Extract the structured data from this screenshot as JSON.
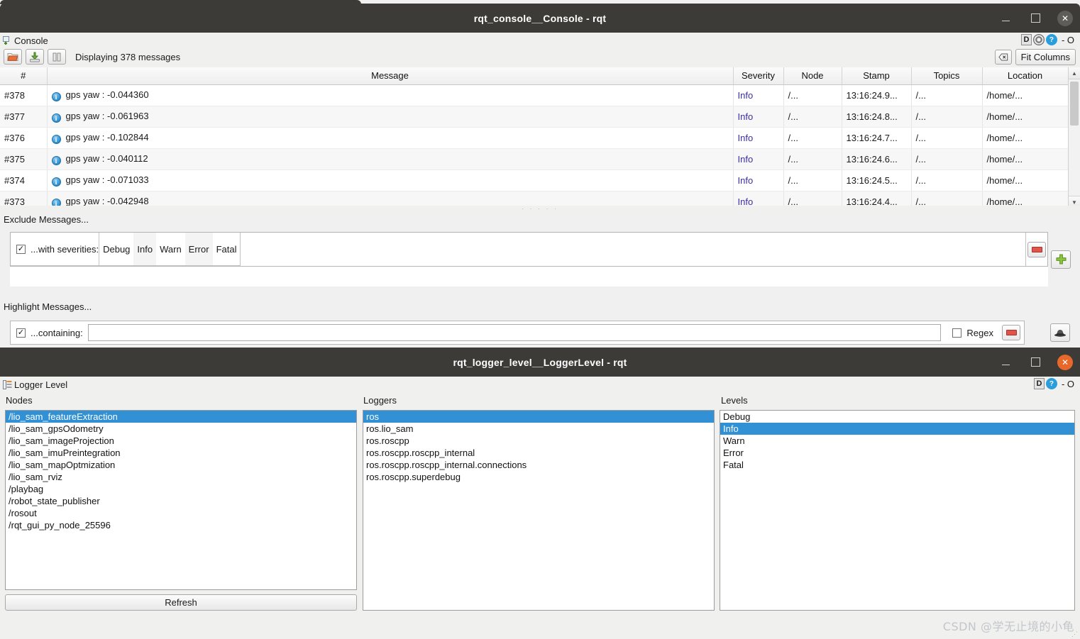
{
  "console_window": {
    "title": "rqt_console__Console - rqt",
    "titlebar_buttons": {
      "minimize": "–",
      "maximize": "□",
      "close": "✕"
    },
    "dock": {
      "title": "Console",
      "icon": "console-dock-icon",
      "controls": {
        "float_label": "D",
        "gear": "⚙",
        "help": "?",
        "extra": "- O"
      }
    },
    "toolbar": {
      "open_icon": "open-folder-icon",
      "save_icon": "save-disk-icon",
      "pause_icon": "pause-icon",
      "status": "Displaying 378 messages",
      "clear_icon": "clear-icon",
      "fit_columns_label": "Fit Columns"
    },
    "table": {
      "columns": [
        "#",
        "Message",
        "Severity",
        "Node",
        "Stamp",
        "Topics",
        "Location"
      ],
      "rows": [
        {
          "num": "#378",
          "message": "gps yaw : -0.044360",
          "severity": "Info",
          "node": "/...",
          "stamp": "13:16:24.9...",
          "topics": "/...",
          "location": "/home/..."
        },
        {
          "num": "#377",
          "message": "gps yaw : -0.061963",
          "severity": "Info",
          "node": "/...",
          "stamp": "13:16:24.8...",
          "topics": "/...",
          "location": "/home/..."
        },
        {
          "num": "#376",
          "message": "gps yaw : -0.102844",
          "severity": "Info",
          "node": "/...",
          "stamp": "13:16:24.7...",
          "topics": "/...",
          "location": "/home/..."
        },
        {
          "num": "#375",
          "message": "gps yaw : -0.040112",
          "severity": "Info",
          "node": "/...",
          "stamp": "13:16:24.6...",
          "topics": "/...",
          "location": "/home/..."
        },
        {
          "num": "#374",
          "message": "gps yaw : -0.071033",
          "severity": "Info",
          "node": "/...",
          "stamp": "13:16:24.5...",
          "topics": "/...",
          "location": "/home/..."
        },
        {
          "num": "#373",
          "message": "gps yaw : -0.042948",
          "severity": "Info",
          "node": "/...",
          "stamp": "13:16:24.4...",
          "topics": "/...",
          "location": "/home/..."
        }
      ]
    },
    "exclude": {
      "label": "Exclude Messages...",
      "checkbox_checked": "✓",
      "row_label": "...with severities:",
      "severities": [
        "Debug",
        "Info",
        "Warn",
        "Error",
        "Fatal"
      ],
      "remove_icon": "minus-icon",
      "add_icon": "plus-icon"
    },
    "highlight": {
      "label": "Highlight Messages...",
      "checkbox_checked": "✓",
      "row_label": "...containing:",
      "text_value": "",
      "regex_label": "Regex",
      "regex_checked": "",
      "remove_icon": "minus-icon",
      "hide_icon": "detective-hat-icon"
    }
  },
  "logger_window": {
    "title": "rqt_logger_level__LoggerLevel - rqt",
    "titlebar_buttons": {
      "minimize": "–",
      "maximize": "□",
      "close": "✕"
    },
    "dock": {
      "title": "Logger Level",
      "icon": "logger-dock-icon",
      "controls": {
        "float_label": "D",
        "help": "?",
        "extra": "- O"
      }
    },
    "nodes": {
      "header": "Nodes",
      "items": [
        "/lio_sam_featureExtraction",
        "/lio_sam_gpsOdometry",
        "/lio_sam_imageProjection",
        "/lio_sam_imuPreintegration",
        "/lio_sam_mapOptmization",
        "/lio_sam_rviz",
        "/playbag",
        "/robot_state_publisher",
        "/rosout",
        "/rqt_gui_py_node_25596"
      ],
      "selected_index": 0,
      "refresh_label": "Refresh"
    },
    "loggers": {
      "header": "Loggers",
      "items": [
        "ros",
        "ros.lio_sam",
        "ros.roscpp",
        "ros.roscpp.roscpp_internal",
        "ros.roscpp.roscpp_internal.connections",
        "ros.roscpp.superdebug"
      ],
      "selected_index": 0
    },
    "levels": {
      "header": "Levels",
      "items": [
        "Debug",
        "Info",
        "Warn",
        "Error",
        "Fatal"
      ],
      "selected_index": 1
    }
  },
  "watermark": "CSDN @学无止境的小龟",
  "colors": {
    "titlebar_bg": "#3c3b37",
    "selection_blue": "#3191d4",
    "severity_text": "#3b2fa5",
    "close_orange": "#e8682c"
  }
}
